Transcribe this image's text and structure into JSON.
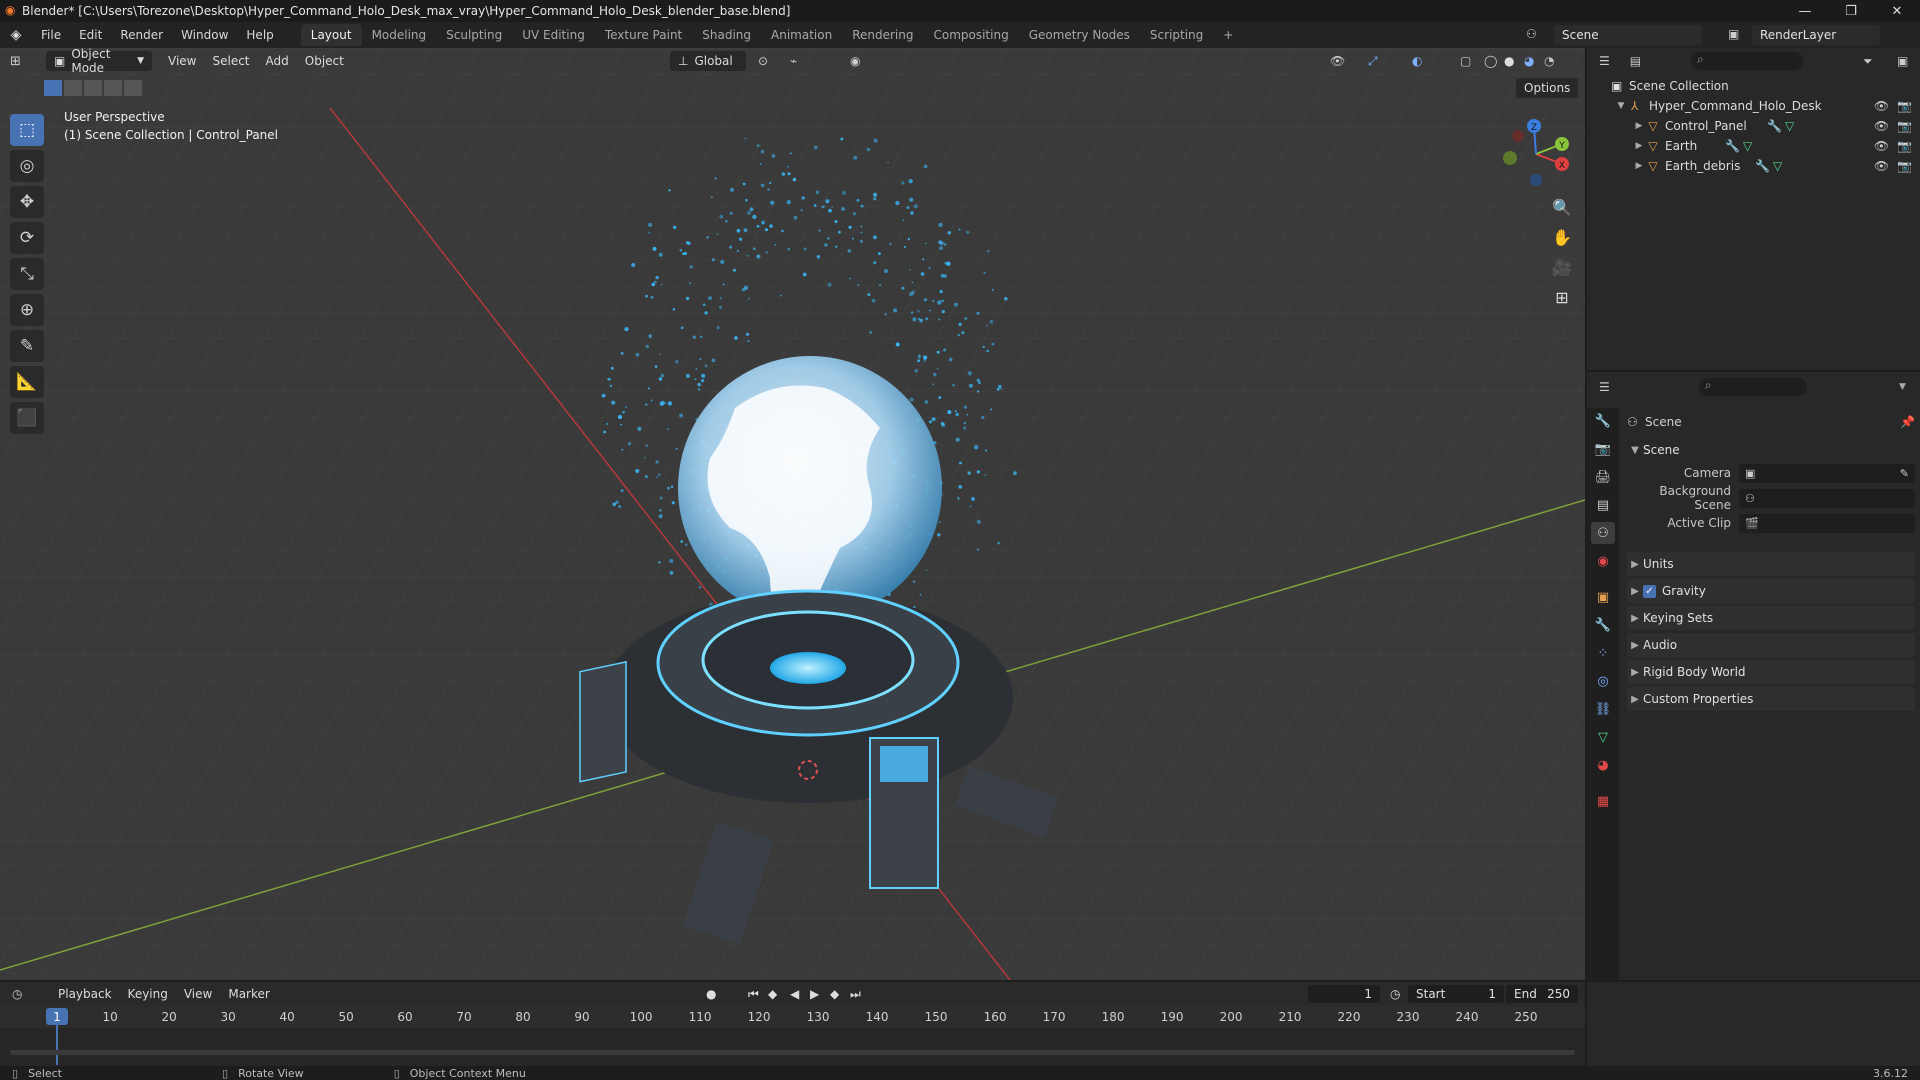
{
  "window": {
    "title": "Blender* [C:\\Users\\Torezone\\Desktop\\Hyper_Command_Holo_Desk_max_vray\\Hyper_Command_Holo_Desk_blender_base.blend]",
    "minimize": "—",
    "maximize": "❐",
    "close": "✕"
  },
  "menubar": {
    "menus": [
      "File",
      "Edit",
      "Render",
      "Window",
      "Help"
    ],
    "workspaces": [
      "Layout",
      "Modeling",
      "Sculpting",
      "UV Editing",
      "Texture Paint",
      "Shading",
      "Animation",
      "Rendering",
      "Compositing",
      "Geometry Nodes",
      "Scripting"
    ],
    "active_workspace": "Layout",
    "add_tab": "+",
    "scene": "Scene",
    "view_layer": "RenderLayer"
  },
  "viewport": {
    "mode": "Object Mode",
    "menus": [
      "View",
      "Select",
      "Add",
      "Object"
    ],
    "transform_orientation": "Global",
    "options": "Options",
    "perspective_label": "User Perspective",
    "context_label": "(1) Scene Collection | Control_Panel",
    "gizmo_axes": [
      "X",
      "Y",
      "Z"
    ]
  },
  "outliner": {
    "root": "Scene Collection",
    "collection": "Hyper_Command_Holo_Desk",
    "objects": [
      "Control_Panel",
      "Earth",
      "Earth_debris"
    ]
  },
  "properties": {
    "context_title": "Scene",
    "scene_panel": "Scene",
    "fields": [
      {
        "label": "Camera",
        "value": ""
      },
      {
        "label": "Background Scene",
        "value": ""
      },
      {
        "label": "Active Clip",
        "value": ""
      }
    ],
    "collapsed_panels": [
      "Units",
      "Gravity",
      "Keying Sets",
      "Audio",
      "Rigid Body World",
      "Custom Properties"
    ],
    "gravity_checked": true
  },
  "timeline": {
    "menus": [
      "Playback",
      "Keying",
      "View",
      "Marker"
    ],
    "current_frame": "1",
    "start_label": "Start",
    "start": "1",
    "end_label": "End",
    "end": "250",
    "ticks": [
      "1",
      "10",
      "20",
      "30",
      "40",
      "50",
      "60",
      "70",
      "80",
      "90",
      "100",
      "110",
      "120",
      "130",
      "140",
      "150",
      "160",
      "170",
      "180",
      "190",
      "200",
      "210",
      "220",
      "230",
      "240",
      "250"
    ]
  },
  "statusbar": {
    "select": "Select",
    "rotate": "Rotate View",
    "context_menu": "Object Context Menu",
    "version": "3.6.12"
  },
  "colors": {
    "accent": "#4772b3",
    "hologram": "#5fd0ff",
    "object_icon": "#e3a151"
  }
}
